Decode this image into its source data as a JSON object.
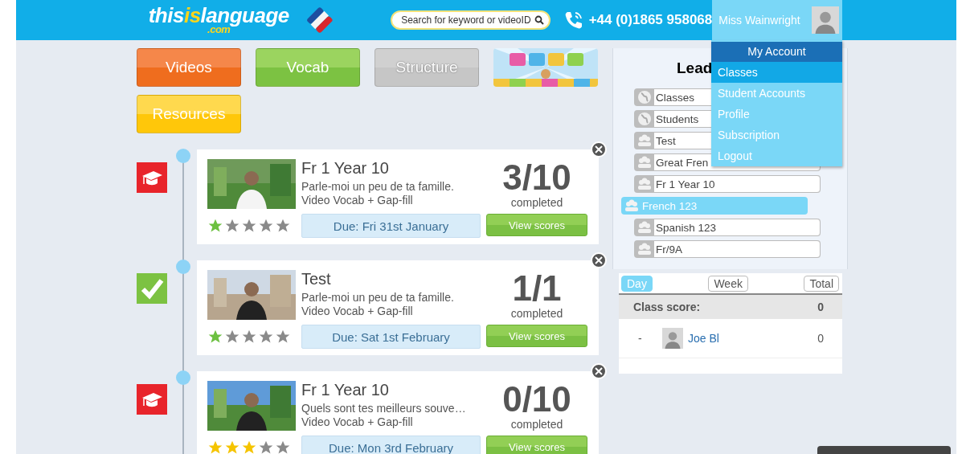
{
  "header": {
    "logo": {
      "parts": [
        "this",
        "is",
        "language"
      ],
      "sub": ".com"
    },
    "search": {
      "placeholder": "Search for keyword or videoID"
    },
    "phone": "+44 (0)1865 958068",
    "user": {
      "name": "Miss Wainwright"
    }
  },
  "account_menu": {
    "title": "My Account",
    "items": [
      {
        "label": "Classes",
        "selected": true
      },
      {
        "label": "Student Accounts",
        "selected": false
      },
      {
        "label": "Profile",
        "selected": false
      },
      {
        "label": "Subscription",
        "selected": false
      },
      {
        "label": "Logout",
        "selected": false
      }
    ]
  },
  "nav_buttons": [
    {
      "label": "Videos",
      "kind": "orange",
      "disabled": false
    },
    {
      "label": "Vocab",
      "kind": "green",
      "disabled": false
    },
    {
      "label": "Structure",
      "kind": "grey",
      "disabled": true
    },
    {
      "kind": "picture"
    },
    {
      "label": "Resources",
      "kind": "yellow",
      "disabled": false
    }
  ],
  "assignments": [
    {
      "kind": "pending",
      "title": "Fr 1 Year 10",
      "description": "Parle-moi un peu de ta famille.",
      "type": "Video Vocab + Gap-fill",
      "score": "3/10",
      "score_label": "completed",
      "due": "Due: Fri 31st January",
      "action": "View scores",
      "stars": 1,
      "color": "#6cc040"
    },
    {
      "kind": "done",
      "title": "Test",
      "description": "Parle-moi un peu de ta famille.",
      "type": "Video Vocab + Gap-fill",
      "score": "1/1",
      "score_label": "completed",
      "due": "Due: Sat 1st February",
      "action": "View scores",
      "stars": 1,
      "color": "#6cc040"
    },
    {
      "kind": "pending",
      "title": "Fr 1 Year 10",
      "description": "Quels sont tes meilleurs souve…",
      "type": "Video Vocab + Gap-fill",
      "score": "0/10",
      "score_label": "completed",
      "due": "Due: Mon 3rd February",
      "action": "View scores",
      "stars": 3,
      "color": "#f5c400"
    }
  ],
  "leaderboard": {
    "title": "Lead",
    "groups": [
      {
        "label": "Classes",
        "kind": "global",
        "selected": false
      },
      {
        "label": "Students",
        "kind": "global",
        "selected": false
      },
      {
        "label": "Test",
        "kind": "class",
        "selected": false
      },
      {
        "label": "Great Fren",
        "kind": "class",
        "selected": false
      },
      {
        "label": "Fr 1 Year 10",
        "kind": "class",
        "selected": false
      },
      {
        "label": "French 123",
        "kind": "class",
        "selected": true
      },
      {
        "label": "Spanish 123",
        "kind": "class",
        "selected": false
      },
      {
        "label": "Fr/9A",
        "kind": "class",
        "selected": false
      }
    ],
    "periods": [
      {
        "label": "Day",
        "selected": true
      },
      {
        "label": "Week",
        "selected": false
      },
      {
        "label": "Total",
        "selected": false
      }
    ],
    "class_score": {
      "label": "Class score:",
      "value": "0"
    },
    "students": [
      {
        "rank": "-",
        "name": "Joe Bl",
        "score": "0"
      }
    ]
  }
}
